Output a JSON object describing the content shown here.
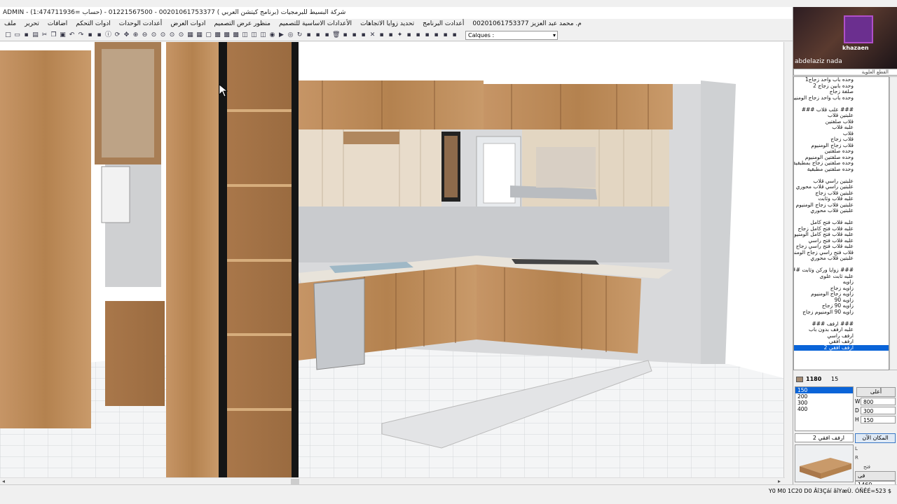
{
  "window": {
    "title": "ADMIN - شركة البسيط للبرمجيات (برنامج كيتشن العربي ) 00201061753377 - 01221567500 - (حساب =1:474711936)"
  },
  "menu": [
    "ملف",
    "تحرير",
    "اضافات",
    "ادوات التحكم",
    "أعدادت الوحدات",
    "ادوات العرض",
    "منظور عرض التصميم",
    "الأعدادات الاساسية للتصميم",
    "تحديد زوايا الاتجاهات",
    "أعدادت البرنامج",
    "م. محمد عبد العزيز 00201061753377"
  ],
  "toolbar": {
    "layer_label": "Calques :",
    "icons": [
      "new-icon",
      "open-icon",
      "save-icon",
      "print-icon",
      "cut-icon",
      "copy-icon",
      "paste-icon",
      "undo-icon",
      "redo-icon",
      "tool-icon",
      "tool-icon",
      "info-icon",
      "rotate-icon",
      "move-icon",
      "zoom-in-icon",
      "zoom-out-icon",
      "zoom-icon",
      "zoom-icon",
      "zoom-icon",
      "zoom-icon",
      "grid-icon",
      "grid-icon",
      "select-icon",
      "box-icon",
      "box-icon",
      "box-icon",
      "view-icon",
      "view-icon",
      "view-icon",
      "camera-icon",
      "play-icon",
      "eye-icon",
      "refresh-icon",
      "tool-icon",
      "tool-icon",
      "tool-icon",
      "delete-icon",
      "tool-icon",
      "tool-icon",
      "tool-icon",
      "close-icon",
      "tool-icon",
      "tool-icon",
      "light-icon",
      "tool-icon",
      "tool-icon",
      "tool-icon",
      "tool-icon",
      "tool-icon",
      "tool-icon"
    ]
  },
  "panel": {
    "presenter": "abdelaziz nada",
    "brand": "khazaen",
    "combo_top": "القطع العلوية",
    "items": [
      "وحده باب واحد زجاج1",
      "وحده بابين زجاج 2",
      "صلفة زجاج",
      "وحده باب واحد زجاج الومنيوم",
      "",
      "### علب قلاب ###",
      "علبتين قلاب",
      "قلاب صلفتين",
      "علبه قلاب",
      "قلاب",
      "قلاب زجاج",
      "قلاب زجاج الومنيوم",
      "وحده صلفتين",
      "وحده صلفتين الومنيوم",
      "وحده صلفتين زجاج بمطبقية",
      "وحده صلفتين مطبقية",
      "",
      "علبتين راسي قلاب",
      "علبتين راسي قلاب محوري",
      "علبتين قلاب زجاج",
      "علبه قلاب وثابت",
      "علبتين قلاب زجاج الومنيوم",
      "علبتين قلاب محوري",
      "",
      "علبه قلاب فتح كامل",
      "علبه قلاب فتح كامل زجاج",
      "علبه قلاب فتح كامل الومنيوم",
      "علبه قلاب فتح راسي",
      "علبه قلاب فتح راسي زجاج",
      "قلاب فتح راسي زجاج الومني",
      "علبتين قلاب محوري",
      "",
      "### زوايا وركن وثابت ###",
      "علبه ثابت علوى",
      "زاويه",
      "زاويه زجاج",
      "زاويه زجاج الومنيوم",
      "زاويه 90",
      "زاويه 90 زجاج",
      "زاويه 90 الومنيوم زجاج",
      "",
      "### ارفف ###",
      "علبه ارفف بدون باب",
      "ارفف راسي",
      "ارفف افقي",
      "ارفف افقي 2"
    ],
    "selected_item": "ارفف افقي 2",
    "color_code": "1180",
    "color_count": "15",
    "sizes": [
      "150",
      "200",
      "300",
      "400"
    ],
    "selected_size": "150",
    "top_button": "أعلى",
    "dims": {
      "w_label": "W",
      "w": "800",
      "d_label": "D",
      "d": "300",
      "h_label": "H",
      "h": "150"
    },
    "name_combo": "ارفف افقي 2",
    "place_button": "المكان الآن",
    "l_label": "L",
    "r_label": "R",
    "field_note": "فتح",
    "small_combo": "فى",
    "bottom_value": "1460"
  },
  "status": {
    "text": "Y0 M0 1C20 D0 Âî3Çáí âîYæÙ. ÓÑÊÉ=523 $"
  },
  "colors": {
    "wood": "#b98a5b",
    "wood_dark": "#9a6e44",
    "selection": "#0a64d8"
  }
}
